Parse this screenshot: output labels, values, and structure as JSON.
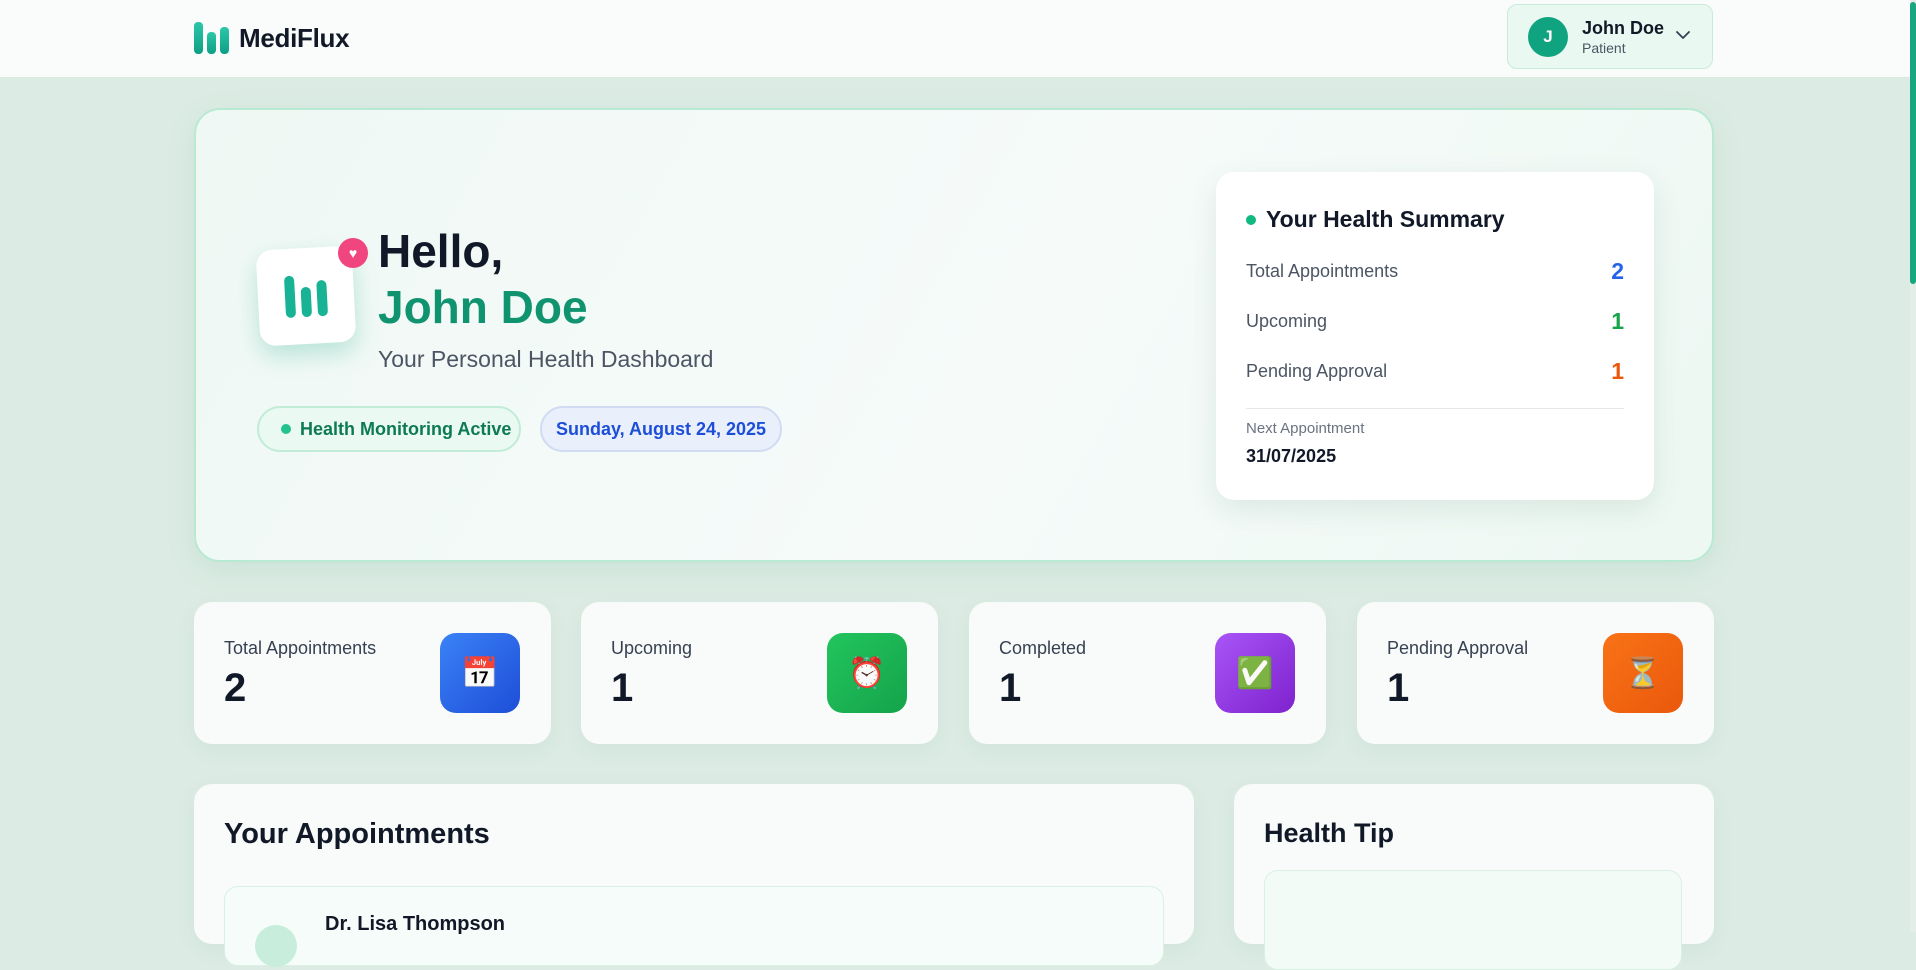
{
  "header": {
    "app_name": "MediFlux",
    "user": {
      "initial": "J",
      "name": "John Doe",
      "role": "Patient"
    }
  },
  "hero": {
    "greeting": "Hello,",
    "name": "John Doe",
    "subtitle": "Your Personal Health Dashboard",
    "status_pill": "Health Monitoring Active",
    "date_pill": "Sunday, August 24, 2025"
  },
  "summary": {
    "title": "Your Health Summary",
    "rows": [
      {
        "label": "Total Appointments",
        "value": "2",
        "color": "#2563eb"
      },
      {
        "label": "Upcoming",
        "value": "1",
        "color": "#16a34a"
      },
      {
        "label": "Pending Approval",
        "value": "1",
        "color": "#ea580c"
      }
    ],
    "next_label": "Next Appointment",
    "next_value": "31/07/2025"
  },
  "stats": [
    {
      "label": "Total Appointments",
      "value": "2",
      "icon": "calendar-icon",
      "glyph": "📅",
      "color": "#2563eb"
    },
    {
      "label": "Upcoming",
      "value": "1",
      "icon": "alarm-clock-icon",
      "glyph": "⏰",
      "color": "#16a34a"
    },
    {
      "label": "Completed",
      "value": "1",
      "icon": "check-icon",
      "glyph": "✅",
      "color": "#9333ea"
    },
    {
      "label": "Pending Approval",
      "value": "1",
      "icon": "hourglass-icon",
      "glyph": "⏳",
      "color": "#ea580c"
    }
  ],
  "appointments": {
    "title": "Your Appointments",
    "items": [
      {
        "doctor": "Dr. Lisa Thompson"
      }
    ]
  },
  "health_tip": {
    "title": "Health Tip"
  },
  "colors": {
    "accent": "#10a37f",
    "background": "#dcece4"
  }
}
